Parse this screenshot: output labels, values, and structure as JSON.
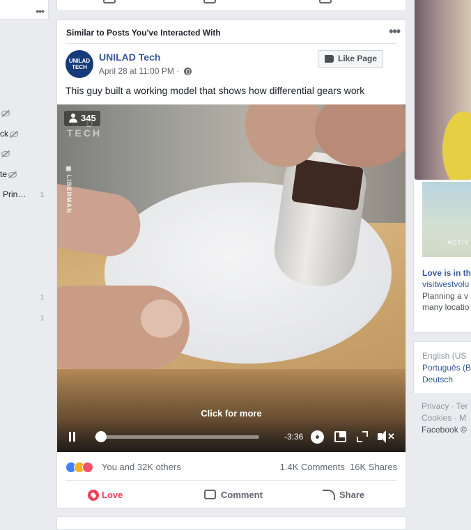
{
  "left_sidebar": {
    "items": [
      {
        "label": "",
        "count": "",
        "hidden_icon": true
      },
      {
        "label": "ck",
        "count": "",
        "hidden_icon": true
      },
      {
        "label": "",
        "count": "",
        "hidden_icon": true
      },
      {
        "label": "te",
        "count": "",
        "hidden_icon": true
      },
      {
        "label": "Prin…",
        "count": "1",
        "hidden_icon": false
      },
      {
        "label": "",
        "count": "1",
        "hidden_icon": false
      },
      {
        "label": "",
        "count": "1",
        "hidden_icon": false
      }
    ]
  },
  "post": {
    "header": "Similar to Posts You've Interacted With",
    "page_name": "UNILAD Tech",
    "avatar_text": "UNILAD TECH",
    "date": "April 28 at 11:00 PM · ",
    "like_page_label": "Like Page",
    "text": "This guy built a working model that shows how differential gears work",
    "video": {
      "viewer_count": "345",
      "watermark": "D\nTECH",
      "vertical_credit": "▣ LIBERMAN",
      "click_for_more": "Click for more",
      "time_remaining": "-3:36",
      "progress": 0.02
    },
    "reactions_text": "You and 32K others",
    "comments_count": "1.4K Comments",
    "shares_count": "16K Shares",
    "actions": {
      "love": "Love",
      "comment": "Comment",
      "share": "Share"
    }
  },
  "right_sidebar": {
    "ad": {
      "image_text": "ACTIV",
      "title": "Love is in th",
      "site": "visitwestvolu",
      "desc1": "Planning a v",
      "desc2": "many locatio"
    },
    "languages": [
      "English (US",
      "Português (B",
      "Deutsch"
    ],
    "footer": [
      "Privacy · Ter",
      "Cookies · M",
      "Facebook ©"
    ]
  },
  "colors": {
    "link": "#365899",
    "love": "#f33e58",
    "like": "#4080ff",
    "bg": "#e9ebee"
  }
}
